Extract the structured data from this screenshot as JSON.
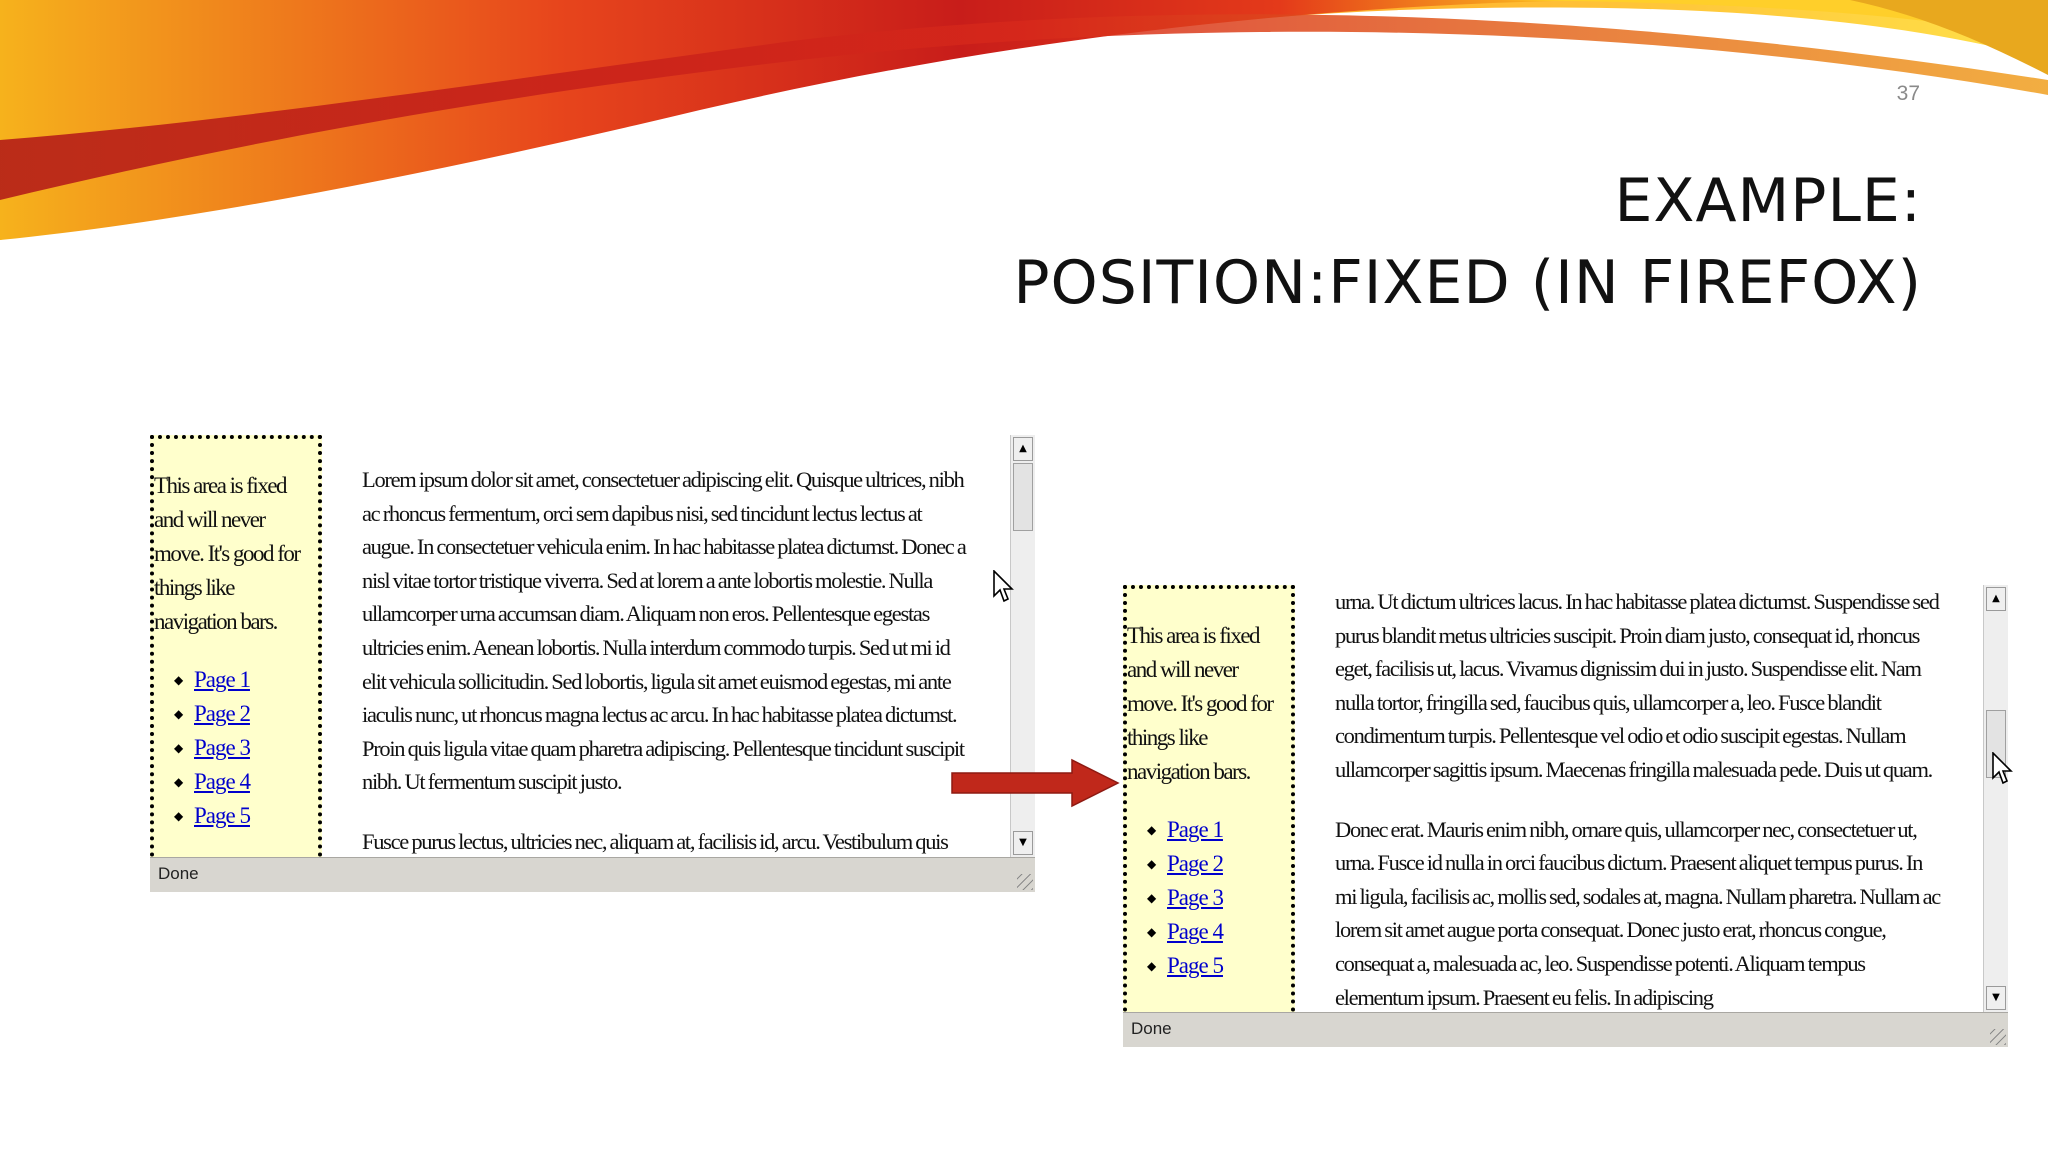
{
  "slide": {
    "number": "37",
    "title_line1": "EXAMPLE:",
    "title_line2": "POSITION:FIXED (IN FIREFOX)"
  },
  "colors": {
    "nav_background": "#ffffcc",
    "link": "#0000cc",
    "arrow": "#c0281b",
    "swoosh_red": "#d7281b",
    "swoosh_orange": "#f28a1e",
    "swoosh_yellow": "#ffd21f"
  },
  "browser_before": {
    "nav_text": "This area is fixed and will never move. It's good for things like navigation bars.",
    "nav_links": [
      "Page 1",
      "Page 2",
      "Page 3",
      "Page 4",
      "Page 5"
    ],
    "paragraphs": [
      "Lorem ipsum dolor sit amet, consectetuer adipiscing elit. Quisque ultrices, nibh ac rhoncus fermentum, orci sem dapibus nisi, sed tincidunt lectus lectus at augue. In consectetuer vehicula enim. In hac habitasse platea dictumst. Donec a nisl vitae tortor tristique viverra. Sed at lorem a ante lobortis molestie. Nulla ullamcorper urna accumsan diam. Aliquam non eros. Pellentesque egestas ultricies enim. Aenean lobortis. Nulla interdum commodo turpis. Sed ut mi id elit vehicula sollicitudin. Sed lobortis, ligula sit amet euismod egestas, mi ante iaculis nunc, ut rhoncus magna lectus ac arcu. In hac habitasse platea dictumst. Proin quis ligula vitae quam pharetra adipiscing. Pellentesque tincidunt suscipit nibh. Ut fermentum suscipit justo.",
      "Fusce purus lectus, ultricies nec, aliquam at, facilisis id, arcu. Vestibulum quis mi"
    ],
    "status": "Done"
  },
  "browser_after": {
    "nav_text": "This area is fixed and will never move. It's good for things like navigation bars.",
    "nav_links": [
      "Page 1",
      "Page 2",
      "Page 3",
      "Page 4",
      "Page 5"
    ],
    "paragraphs": [
      "urna. Ut dictum ultrices lacus. In hac habitasse platea dictumst. Suspendisse sed purus blandit metus ultricies suscipit. Proin diam justo, consequat id, rhoncus eget, facilisis ut, lacus. Vivamus dignissim dui in justo. Suspendisse elit. Nam nulla tortor, fringilla sed, faucibus quis, ullamcorper a, leo. Fusce blandit condimentum turpis. Pellentesque vel odio et odio suscipit egestas. Nullam ullamcorper sagittis ipsum. Maecenas fringilla malesuada pede. Duis ut quam.",
      "Donec erat. Mauris enim nibh, ornare quis, ullamcorper nec, consectetuer ut, urna. Fusce id nulla in orci faucibus dictum. Praesent aliquet tempus purus. In mi ligula, facilisis ac, mollis sed, sodales at, magna. Nullam pharetra. Nullam ac lorem sit amet augue porta consequat. Donec justo erat, rhoncus congue, consequat a, malesuada ac, leo. Suspendisse potenti. Aliquam tempus elementum ipsum. Praesent eu felis. In adipiscing"
    ],
    "status": "Done"
  },
  "icons": {
    "scroll_up": "scroll-up-arrow-icon",
    "scroll_down": "scroll-down-arrow-icon",
    "cursor": "mouse-pointer-icon",
    "resize": "resize-grip-icon",
    "transition": "right-arrow-icon"
  }
}
